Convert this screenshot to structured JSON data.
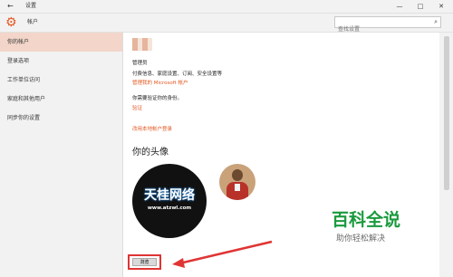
{
  "window": {
    "title": "设置",
    "back_icon": "←",
    "minimize": "—",
    "maximize": "□",
    "close": "✕"
  },
  "header": {
    "section": "帐户",
    "search_placeholder": "查找设置",
    "search_icon": "⌕"
  },
  "sidebar": {
    "items": [
      {
        "label": "你的帐户"
      },
      {
        "label": "登录选项"
      },
      {
        "label": "工作单位访问"
      },
      {
        "label": "家庭和其他用户"
      },
      {
        "label": "同步你的设置"
      }
    ]
  },
  "account": {
    "role": "管理员",
    "billing": "付费信息、家庭设置、订阅、安全设置等",
    "manage_link": "管理我的 Microsoft 帐户",
    "verify_prompt": "你需要验证你的身份。",
    "verify_link": "验证",
    "local_link": "改用本地帐户登录"
  },
  "avatar": {
    "heading": "你的头像",
    "browse": "浏览"
  },
  "watermark": {
    "main": "天桂网络",
    "url": "www.atzwl.com"
  },
  "brand": {
    "title": "百科全说",
    "subtitle": "助你轻松解决"
  },
  "colors": {
    "accent": "#e25822",
    "highlight_box": "#e03434",
    "brand_green": "#1a9a3d"
  }
}
